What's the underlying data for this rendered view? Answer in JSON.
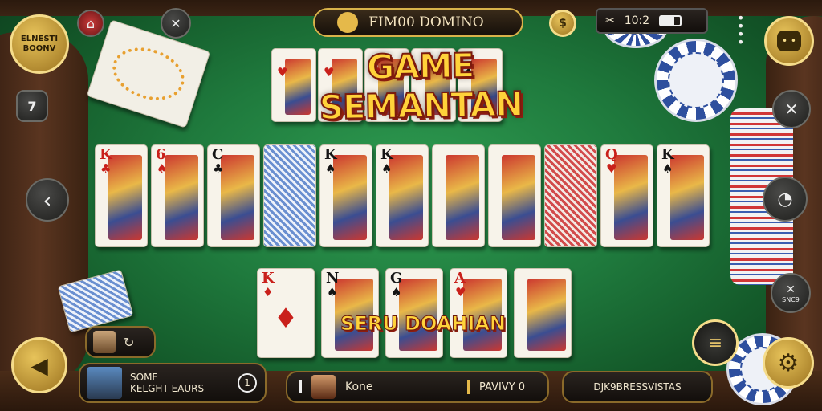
{
  "top_bar": {
    "title": "FIM00 DOMINO",
    "time": "10:2",
    "left_badge": "ELNESTI BOONV"
  },
  "title_text": "GAME SEMANTAN",
  "promo_text": "SERU DOAHIAN",
  "left_tools": {
    "seven_label": "7"
  },
  "right_tools": {
    "side_label": "SNC9"
  },
  "players": {
    "left_player_line1": "SOMF",
    "left_player_line2": "KELGHT EAURS",
    "left_player_count": "1",
    "center_name": "Kone",
    "center_status": "PAVIVY 0",
    "right_label": "DJK9BRESSVISTAS"
  },
  "cards_top": [
    {
      "rank": "",
      "suit": "♥",
      "color": "red"
    },
    {
      "rank": "",
      "suit": "♥",
      "color": "red"
    },
    {
      "rank": "",
      "suit": "♥",
      "color": "red"
    },
    {
      "rank": "",
      "suit": "♠",
      "color": "blk"
    },
    {
      "rank": "",
      "suit": "♠",
      "color": "blk"
    }
  ],
  "cards_middle": [
    {
      "rank": "K",
      "suit": "♣",
      "color": "red"
    },
    {
      "rank": "6",
      "suit": "♠",
      "color": "red"
    },
    {
      "rank": "C",
      "suit": "♣",
      "color": "blk"
    },
    {
      "rank": "",
      "suit": "",
      "color": "blk"
    },
    {
      "rank": "K",
      "suit": "♠",
      "color": "blk"
    },
    {
      "rank": "K",
      "suit": "♠",
      "color": "blk"
    },
    {
      "rank": "",
      "suit": "",
      "color": "blk"
    },
    {
      "rank": "",
      "suit": "",
      "color": "blk"
    },
    {
      "rank": "",
      "suit": "",
      "color": "red"
    },
    {
      "rank": "Q",
      "suit": "♥",
      "color": "red"
    },
    {
      "rank": "K",
      "suit": "♠",
      "color": "blk"
    }
  ],
  "cards_bottom": [
    {
      "rank": "K",
      "suit": "♦",
      "color": "red"
    },
    {
      "rank": "N",
      "suit": "♠",
      "color": "blk"
    },
    {
      "rank": "G",
      "suit": "♠",
      "color": "blk"
    },
    {
      "rank": "A",
      "suit": "♥",
      "color": "red"
    },
    {
      "rank": "",
      "suit": "",
      "color": "blk"
    }
  ]
}
